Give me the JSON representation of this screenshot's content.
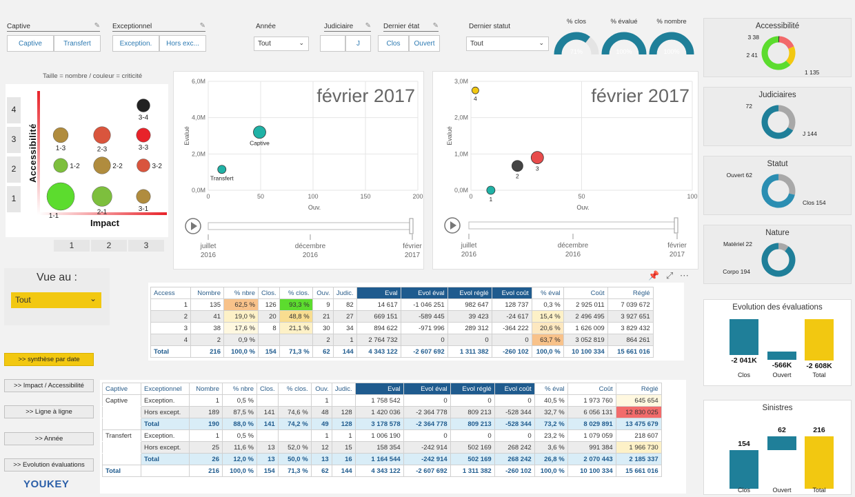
{
  "slicers": {
    "captive": {
      "title": "Captive",
      "options": [
        "Captive",
        "Transfert"
      ]
    },
    "exceptionnel": {
      "title": "Exceptionnel",
      "options": [
        "Exception.",
        "Hors exc..."
      ]
    },
    "annee": {
      "title": "Année",
      "value": "Tout"
    },
    "judiciaire": {
      "title": "Judiciaire",
      "options": [
        "",
        "J"
      ]
    },
    "dernier_etat": {
      "title": "Dernier état",
      "options": [
        "Clos",
        "Ouvert"
      ]
    },
    "dernier_statut": {
      "title": "Dernier statut",
      "value": "Tout"
    }
  },
  "gauges": [
    {
      "title": "% clos",
      "value": "71%",
      "pct": 0.71
    },
    {
      "title": "% évalué",
      "value": "100%",
      "pct": 1.0
    },
    {
      "title": "% nombre",
      "value": "100%",
      "pct": 1.0
    }
  ],
  "matrix": {
    "caption": "Taille = nombre / couleur = criticité",
    "ylabel": "Accessibilité",
    "xlabel": "Impact",
    "rows": [
      "4",
      "3",
      "2",
      "1"
    ],
    "cols": [
      "1",
      "2",
      "3"
    ],
    "bubbles": [
      {
        "label": "3-4",
        "x": 3,
        "y": 4,
        "size": 0.25,
        "color": "#222222"
      },
      {
        "label": "1-3",
        "x": 1,
        "y": 3,
        "size": 0.35,
        "color": "#b08c3e"
      },
      {
        "label": "2-3",
        "x": 2,
        "y": 3,
        "size": 0.45,
        "color": "#d9553d"
      },
      {
        "label": "3-3",
        "x": 3,
        "y": 3,
        "size": 0.3,
        "color": "#e8232a"
      },
      {
        "label": "1-2",
        "x": 1,
        "y": 2,
        "size": 0.3,
        "color": "#7dbf3d"
      },
      {
        "label": "2-2",
        "x": 2,
        "y": 2,
        "size": 0.45,
        "color": "#b08c3e"
      },
      {
        "label": "3-2",
        "x": 3,
        "y": 2,
        "size": 0.25,
        "color": "#d9553d"
      },
      {
        "label": "1-1",
        "x": 1,
        "y": 1,
        "size": 1.0,
        "color": "#5cdc2e"
      },
      {
        "label": "2-1",
        "x": 2,
        "y": 1,
        "size": 0.6,
        "color": "#7dbf3d"
      },
      {
        "label": "3-1",
        "x": 3,
        "y": 1,
        "size": 0.3,
        "color": "#b08c3e"
      }
    ]
  },
  "scatter1": {
    "title": "février 2017",
    "xlabel": "Ouv.",
    "ylabel": "Evalué",
    "xticks": [
      "0",
      "50",
      "100",
      "150",
      "200"
    ],
    "yticks": [
      "0,0M",
      "2,0M",
      "4,0M",
      "6,0M"
    ],
    "xlim": [
      0,
      200
    ],
    "ylim": [
      0,
      6
    ],
    "points": [
      {
        "label": "Captive",
        "x": 49,
        "y": 3.2,
        "r": 9,
        "color": "#20b2a6"
      },
      {
        "label": "Transfert",
        "x": 13,
        "y": 1.15,
        "r": 6,
        "color": "#20b2a6"
      }
    ],
    "timeline": [
      "juillet",
      "2016",
      "décembre",
      "2016",
      "février",
      "2017"
    ]
  },
  "scatter2": {
    "title": "février 2017",
    "xlabel": "Ouv.",
    "ylabel": "Evalué",
    "xticks": [
      "0",
      "50",
      "100"
    ],
    "yticks": [
      "0,0M",
      "1,0M",
      "2,0M",
      "3,0M"
    ],
    "xlim": [
      0,
      100
    ],
    "ylim": [
      0,
      3
    ],
    "points": [
      {
        "label": "4",
        "x": 2,
        "y": 2.75,
        "r": 5,
        "color": "#f2c811"
      },
      {
        "label": "3",
        "x": 30,
        "y": 0.9,
        "r": 9,
        "color": "#e84c4c"
      },
      {
        "label": "2",
        "x": 21,
        "y": 0.67,
        "r": 8,
        "color": "#444444"
      },
      {
        "label": "1",
        "x": 9,
        "y": 0.0,
        "r": 6,
        "color": "#20b2a6"
      }
    ],
    "timeline": [
      "juillet",
      "2016",
      "décembre",
      "2016",
      "février",
      "2017"
    ]
  },
  "donuts": [
    {
      "title": "Accessibilité",
      "labels": [
        "3 38",
        "2 41",
        "1 135"
      ],
      "slices": [
        {
          "v": 2,
          "c": "#333333"
        },
        {
          "v": 38,
          "c": "#f2696a"
        },
        {
          "v": 41,
          "c": "#f2c811"
        },
        {
          "v": 135,
          "c": "#5cdc2e"
        }
      ]
    },
    {
      "title": "Judiciaires",
      "labels": [
        "72",
        "J 144"
      ],
      "slices": [
        {
          "v": 72,
          "c": "#a8a8a8"
        },
        {
          "v": 144,
          "c": "#1f7f99"
        }
      ]
    },
    {
      "title": "Statut",
      "labels": [
        "Ouvert 62",
        "Clos 154"
      ],
      "slices": [
        {
          "v": 62,
          "c": "#a8a8a8"
        },
        {
          "v": 154,
          "c": "#2b8eb2"
        }
      ]
    },
    {
      "title": "Nature",
      "labels": [
        "Matériel 22",
        "Corpo 194"
      ],
      "slices": [
        {
          "v": 22,
          "c": "#a8a8a8"
        },
        {
          "v": 194,
          "c": "#1f7f99"
        }
      ]
    }
  ],
  "waterfalls": [
    {
      "title": "Evolution des évaluations",
      "labels": [
        "-2 041K",
        "-566K",
        "-2 608K"
      ],
      "cats": [
        "Clos",
        "Ouvert",
        "Total"
      ]
    },
    {
      "title": "Sinistres",
      "labels": [
        "154",
        "62",
        "216"
      ],
      "cats": [
        "Clos",
        "Ouvert",
        "Total"
      ]
    }
  ],
  "vue_au": {
    "title": "Vue au :",
    "value": "Tout"
  },
  "nav": [
    ">> synthèse par date",
    ">> Impact / Accessibilité",
    ">> Ligne à ligne",
    ">> Année",
    ">> Evolution évaluations"
  ],
  "logo": "YOUKEY",
  "table1": {
    "headers": [
      "Access",
      "Nombre",
      "% nbre",
      "Clos.",
      "% clos.",
      "Ouv.",
      "Judic.",
      "Eval",
      "Evol éval",
      "Evol réglé",
      "Evol coût",
      "% éval",
      "Coût",
      "Réglé"
    ],
    "rows": [
      [
        "1",
        "135",
        "62,5 %",
        "126",
        "93,3 %",
        "9",
        "82",
        "14 617",
        "-1 046 251",
        "982 647",
        "128 737",
        "0,3 %",
        "2 925 011",
        "7 039 672"
      ],
      [
        "2",
        "41",
        "19,0 %",
        "20",
        "48,8 %",
        "21",
        "27",
        "669 151",
        "-589 445",
        "39 423",
        "-24 617",
        "15,4 %",
        "2 496 495",
        "3 927 651"
      ],
      [
        "3",
        "38",
        "17,6 %",
        "8",
        "21,1 %",
        "30",
        "34",
        "894 622",
        "-971 996",
        "289 312",
        "-364 222",
        "20,6 %",
        "1 626 009",
        "3 829 432"
      ],
      [
        "4",
        "2",
        "0,9 %",
        "",
        "",
        "2",
        "1",
        "2 764 732",
        "0",
        "0",
        "0",
        "63,7 %",
        "3 052 819",
        "864 261"
      ]
    ],
    "total": [
      "Total",
      "216",
      "100,0 %",
      "154",
      "71,3 %",
      "62",
      "144",
      "4 343 122",
      "-2 607 692",
      "1 311 382",
      "-260 102",
      "100,0 %",
      "10 100 334",
      "15 661 016"
    ]
  },
  "table2": {
    "headers": [
      "Captive",
      "Exceptionnel",
      "Nombre",
      "% nbre",
      "Clos.",
      "% clos.",
      "Ouv.",
      "Judic.",
      "Eval",
      "Evol éval",
      "Evol réglé",
      "Evol coût",
      "% éval",
      "Coût",
      "Réglé"
    ],
    "rows": [
      [
        "Captive",
        "Exception.",
        "1",
        "0,5 %",
        "",
        "",
        "1",
        "",
        "1 758 542",
        "0",
        "0",
        "0",
        "40,5 %",
        "1 973 760",
        "645 654"
      ],
      [
        "",
        "Hors except.",
        "189",
        "87,5 %",
        "141",
        "74,6 %",
        "48",
        "128",
        "1 420 036",
        "-2 364 778",
        "809 213",
        "-528 344",
        "32,7 %",
        "6 056 131",
        "12 830 025"
      ],
      [
        "",
        "Total",
        "190",
        "88,0 %",
        "141",
        "74,2 %",
        "49",
        "128",
        "3 178 578",
        "-2 364 778",
        "809 213",
        "-528 344",
        "73,2 %",
        "8 029 891",
        "13 475 679"
      ],
      [
        "Transfert",
        "Exception.",
        "1",
        "0,5 %",
        "",
        "",
        "1",
        "1",
        "1 006 190",
        "0",
        "0",
        "0",
        "23,2 %",
        "1 079 059",
        "218 607"
      ],
      [
        "",
        "Hors except.",
        "25",
        "11,6 %",
        "13",
        "52,0 %",
        "12",
        "15",
        "158 354",
        "-242 914",
        "502 169",
        "268 242",
        "3,6 %",
        "991 384",
        "1 966 730"
      ],
      [
        "",
        "Total",
        "26",
        "12,0 %",
        "13",
        "50,0 %",
        "13",
        "16",
        "1 164 544",
        "-242 914",
        "502 169",
        "268 242",
        "26,8 %",
        "2 070 443",
        "2 185 337"
      ]
    ],
    "total": [
      "Total",
      "",
      "216",
      "100,0 %",
      "154",
      "71,3 %",
      "62",
      "144",
      "4 343 122",
      "-2 607 692",
      "1 311 382",
      "-260 102",
      "100,0 %",
      "10 100 334",
      "15 661 016"
    ]
  }
}
